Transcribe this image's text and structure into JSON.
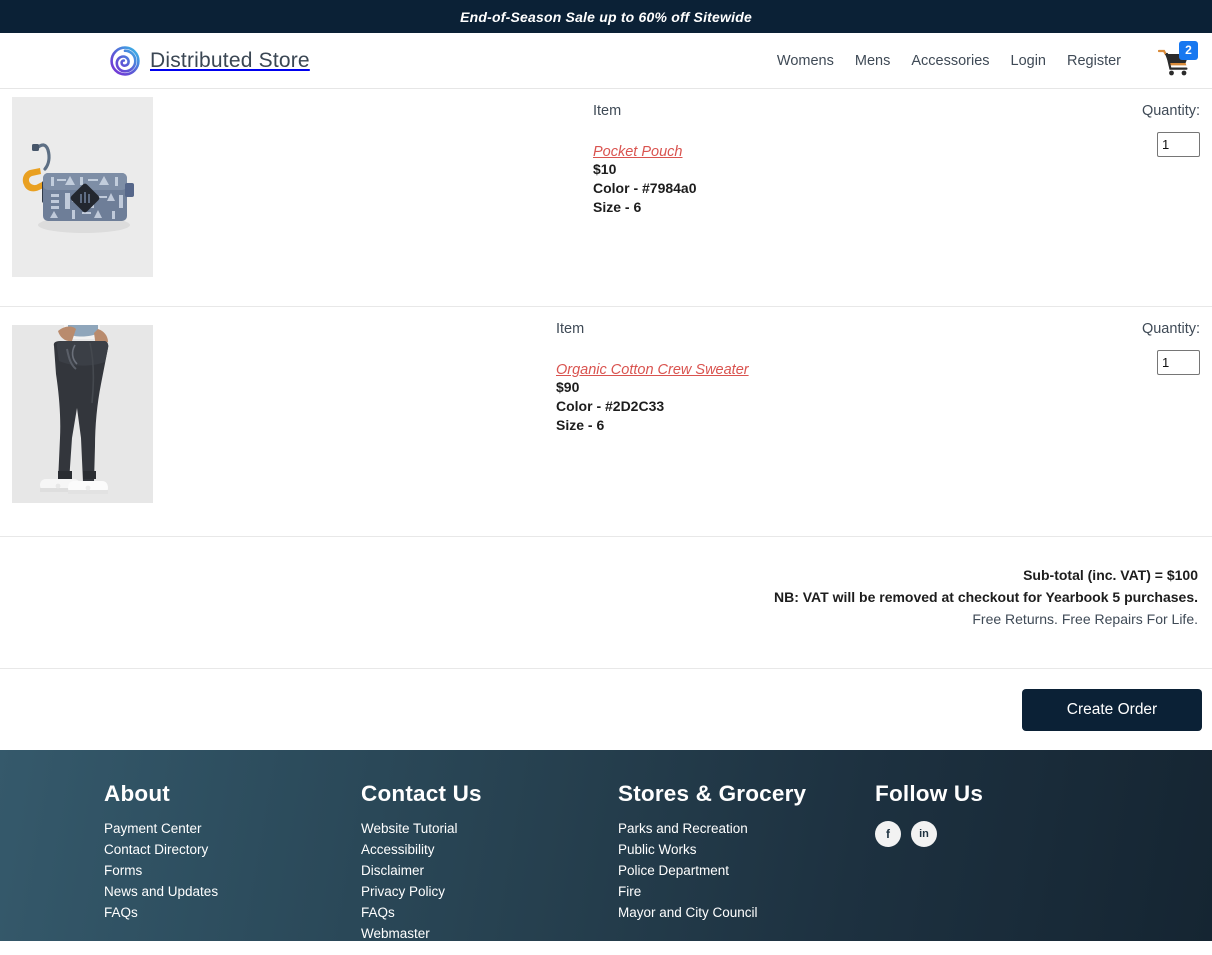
{
  "promo": {
    "text": "End-of-Season Sale up to 60% off Sitewide"
  },
  "header": {
    "brand_name": "Distributed Store",
    "nav": [
      {
        "label": "Womens"
      },
      {
        "label": "Mens"
      },
      {
        "label": "Accessories"
      },
      {
        "label": "Login"
      },
      {
        "label": "Register"
      }
    ],
    "cart_badge_count": "2"
  },
  "cart": {
    "item_label": "Item",
    "quantity_label": "Quantity:",
    "items": [
      {
        "item_label": "Item",
        "name": "Pocket Pouch",
        "price": "$10",
        "color": "Color - #7984a0",
        "size": "Size - 6",
        "quantity": "1",
        "quantity_label": "Quantity:"
      },
      {
        "item_label": "Item",
        "name": "Organic Cotton Crew Sweater",
        "price": "$90",
        "color": "Color - #2D2C33",
        "size": "Size - 6",
        "quantity": "1",
        "quantity_label": "Quantity:"
      }
    ]
  },
  "totals": {
    "subtotal": "Sub-total (inc. VAT) = $100",
    "vat_note": "NB: VAT will be removed at checkout for Yearbook 5 purchases.",
    "returns_note": "Free Returns. Free Repairs For Life."
  },
  "actions": {
    "create_order_label": "Create Order"
  },
  "footer": {
    "columns": [
      {
        "heading": "About",
        "links": [
          {
            "label": "Payment Center"
          },
          {
            "label": "Contact Directory"
          },
          {
            "label": "Forms"
          },
          {
            "label": "News and Updates"
          },
          {
            "label": "FAQs"
          }
        ]
      },
      {
        "heading": "Contact Us",
        "links": [
          {
            "label": "Website Tutorial"
          },
          {
            "label": "Accessibility"
          },
          {
            "label": "Disclaimer"
          },
          {
            "label": "Privacy Policy"
          },
          {
            "label": "FAQs"
          },
          {
            "label": "Webmaster"
          }
        ]
      },
      {
        "heading": "Stores & Grocery",
        "links": [
          {
            "label": "Parks and Recreation"
          },
          {
            "label": "Public Works"
          },
          {
            "label": "Police Department"
          },
          {
            "label": "Fire"
          },
          {
            "label": "Mayor and City Council"
          }
        ]
      }
    ],
    "follow": {
      "heading": "Follow Us",
      "socials": [
        {
          "label": "f",
          "name": "facebook"
        },
        {
          "label": "in",
          "name": "linkedin"
        }
      ]
    }
  },
  "colors": {
    "promo_bg": "#0b2136",
    "accent_red": "#d9534f",
    "badge_blue": "#1878f0",
    "button_navy": "#0b2136"
  }
}
